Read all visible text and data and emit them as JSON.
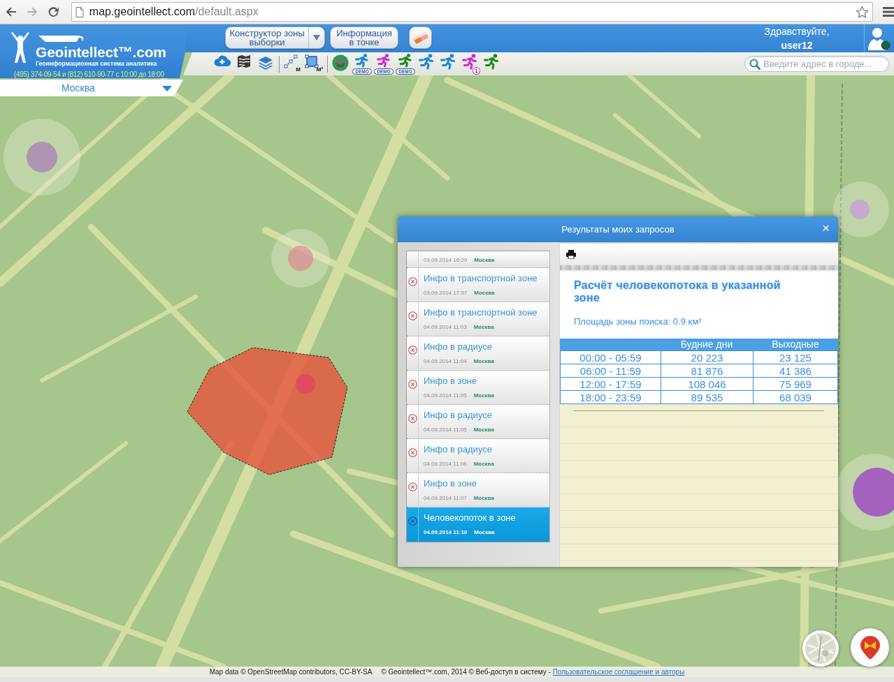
{
  "browser": {
    "url_host": "map.geointellect.com",
    "url_path": "/default.aspx"
  },
  "header": {
    "logo": {
      "name": "Geointellect™.com",
      "tagline": "Геоинформационная система аналитика",
      "phone": "(495) 374-09-54 и (812) 610-90-77 с 10:00 до 18:00"
    },
    "city": "Москва",
    "buttons": [
      {
        "kind": "dropdown",
        "label": "Конструктор зоны выборки"
      },
      {
        "kind": "plain",
        "label": "Информация в точке"
      },
      {
        "kind": "eraser"
      }
    ],
    "greeting": "Здравствуйте,",
    "user": "user12"
  },
  "toolbar": {
    "groups": [
      {
        "tools": [
          {
            "kind": "cloud-add"
          },
          {
            "kind": "map"
          },
          {
            "kind": "layers"
          }
        ]
      },
      {
        "tools": [
          {
            "kind": "line-measure",
            "unit": "М"
          },
          {
            "kind": "area-measure",
            "unit": "М²"
          }
        ]
      },
      {
        "tools": [
          {
            "kind": "cap"
          },
          {
            "kind": "runner",
            "color": "#1d87d6",
            "label": "DEMO"
          },
          {
            "kind": "runner",
            "color": "#d12ad6",
            "label": "DEMO"
          },
          {
            "kind": "runner",
            "color": "#1a8a1e",
            "label": "DEMO"
          },
          {
            "kind": "runner",
            "color": "#1d87d6"
          },
          {
            "kind": "runner",
            "color": "#1d87d6"
          },
          {
            "kind": "runner",
            "color": "#d12ad6",
            "count": "1"
          },
          {
            "kind": "runner",
            "color": "#1a8a1e"
          }
        ]
      }
    ],
    "search": {
      "placeholder": "Введите адрес в городе..."
    }
  },
  "dialog": {
    "title": "Результаты моих запросов",
    "close": "×",
    "requests": [
      {
        "date": "03.09.2014 16:29",
        "city": "Москва",
        "selected": false
      },
      {
        "title": "Инфо в транспортной зоне",
        "date": "03.09.2014 17:57",
        "city": "Москва",
        "selected": false
      },
      {
        "title": "Инфо в транспортной зоне",
        "date": "04.09.2014 11:03",
        "city": "Москва",
        "selected": false
      },
      {
        "title": "Инфо в радиусе",
        "date": "04.09.2014 11:04",
        "city": "Москва",
        "selected": false
      },
      {
        "title": "Инфо в зоне",
        "date": "04.09.2014 11:05",
        "city": "Москва",
        "selected": false
      },
      {
        "title": "Инфо в радиусе",
        "date": "04.09.2014 11:05",
        "city": "Москва",
        "selected": false
      },
      {
        "title": "Инфо в радиусе",
        "date": "04.09.2014 11:06",
        "city": "Москва",
        "selected": false
      },
      {
        "title": "Инфо в зоне",
        "date": "04.09.2014 11:07",
        "city": "Москва",
        "selected": false
      },
      {
        "title": "Человекопоток в зоне",
        "date": "04.09.2014 11:10",
        "city": "Москва",
        "selected": true
      }
    ],
    "report": {
      "title": "Расчёт человекопотока в указанной зоне",
      "area": "Площадь зоны поиска: 0.9 км²",
      "table": {
        "columns": [
          "Будние дни",
          "Выходные"
        ],
        "rows": [
          {
            "period": "00:00 - 05:59",
            "values": [
              "20 223",
              "23 125"
            ]
          },
          {
            "period": "06:00 - 11:59",
            "values": [
              "81 876",
              "41 386"
            ]
          },
          {
            "period": "12:00 - 17:59",
            "values": [
              "108 046",
              "75 969"
            ]
          },
          {
            "period": "18:00 - 23:59",
            "values": [
              "89 535",
              "68 039"
            ]
          }
        ]
      }
    }
  },
  "footer": {
    "attribution": "Map data © OpenStreetMap contributors, CC-BY-SA",
    "copyright": "© Geointellect™.com, 2014 © Веб-доступ в систему -",
    "link": "Пользовательское соглашение и авторы"
  }
}
